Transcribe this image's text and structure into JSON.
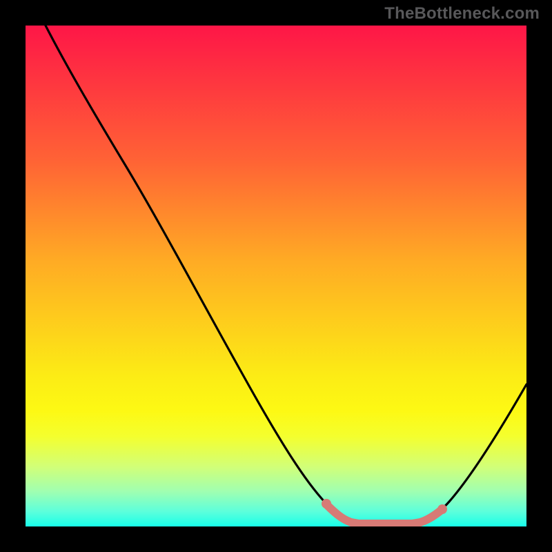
{
  "watermark": "TheBottleneck.com",
  "chart_data": {
    "type": "line",
    "title": "",
    "xlabel": "",
    "ylabel": "",
    "xlim": [
      0,
      100
    ],
    "ylim": [
      0,
      100
    ],
    "x": [
      4,
      10,
      20,
      30,
      40,
      50,
      57,
      61,
      64,
      68,
      72,
      76,
      80,
      82,
      86,
      90,
      94,
      98,
      100
    ],
    "values": [
      100,
      89,
      72,
      55,
      38,
      22,
      11,
      5,
      1,
      0,
      0,
      0,
      0,
      1,
      4,
      10,
      18,
      27,
      33
    ],
    "series": [
      {
        "name": "bottleneck-curve",
        "x": [
          4,
          10,
          20,
          30,
          40,
          50,
          57,
          61,
          64,
          68,
          72,
          76,
          80,
          82,
          86,
          90,
          94,
          98,
          100
        ],
        "values": [
          100,
          89,
          72,
          55,
          38,
          22,
          11,
          5,
          1,
          0,
          0,
          0,
          0,
          1,
          4,
          10,
          18,
          27,
          33
        ]
      }
    ],
    "highlight_range_x": [
      61,
      82
    ],
    "highlight_color": "#d77a75",
    "curve_color": "#000000",
    "gradient_stops": [
      {
        "pos": 0,
        "color": "#fe1647"
      },
      {
        "pos": 27,
        "color": "#ff6335"
      },
      {
        "pos": 47,
        "color": "#ffab24"
      },
      {
        "pos": 70,
        "color": "#fcec15"
      },
      {
        "pos": 82,
        "color": "#f4ff2e"
      },
      {
        "pos": 93,
        "color": "#a0ffb1"
      },
      {
        "pos": 100,
        "color": "#18ffe9"
      }
    ]
  }
}
